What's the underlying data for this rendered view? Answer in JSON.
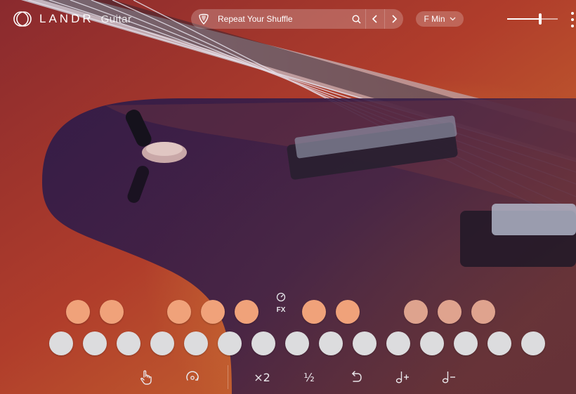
{
  "app": {
    "brand": "LANDR",
    "product": "Guitar"
  },
  "preset": {
    "name": "Repeat Your Shuffle",
    "icons": [
      "pick-icon",
      "search-icon",
      "chevron-left-icon",
      "chevron-right-icon"
    ]
  },
  "key": {
    "value": "F Min"
  },
  "volume": {
    "level": 0.65
  },
  "fx": {
    "label": "FX"
  },
  "toolbar": {
    "double_label": "×2",
    "half_label": "½",
    "icons": [
      "touch-icon",
      "sync-icon",
      "undo-icon",
      "note-add-icon",
      "note-remove-icon"
    ]
  },
  "colors": {
    "pad_active": "#f0a27a",
    "pad_inactive": "#dcdcde",
    "background": "#7a2a24"
  }
}
